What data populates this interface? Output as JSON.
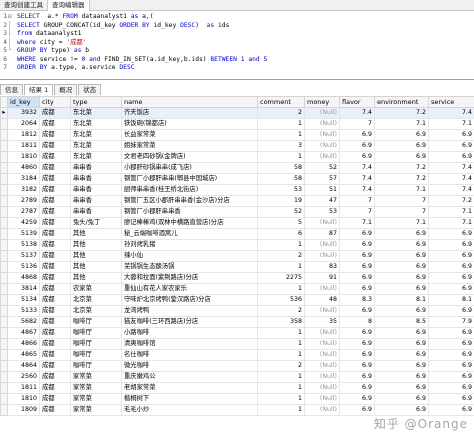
{
  "top_tabs": [
    "查询创建工具",
    "查询编辑器"
  ],
  "sql": {
    "lines": [
      {
        "no": "1",
        "fold": "⊟",
        "html": "<span class='kw'>SELECT</span>  a.* <span class='kw'>FROM</span> dataanalyst1 <span class='kw'>as</span> a,("
      },
      {
        "no": "2",
        "fold": "│",
        "html": "<span class='kw'>SELECT</span> GROUP_CONCAT(id_key <span class='kw'>ORDER BY</span> id_key <span class='kw'>DESC</span>)  <span class='kw'>as</span> ids"
      },
      {
        "no": "3",
        "fold": "│",
        "html": "<span class='kw'>from</span> dataanalyst1"
      },
      {
        "no": "4",
        "fold": "│",
        "html": "<span class='kw'>where</span> city = <span class='str'>'成都'</span>"
      },
      {
        "no": "5",
        "fold": "└",
        "html": "<span class='kw'>GROUP BY</span> type) <span class='kw'>as</span> b"
      },
      {
        "no": "6",
        "fold": "",
        "html": "<span class='kw'>WHERE</span> service != <span class='num'>0</span> <span class='kw'>and</span> FIND_IN_SET(a.id_key,b.ids) <span class='kw'>BETWEEN</span> <span class='num'>1</span> <span class='kw'>and</span> <span class='num'>5</span>"
      },
      {
        "no": "7",
        "fold": "",
        "html": "<span class='kw'>ORDER BY</span> a.type, a.service <span class='kw'>DESC</span>"
      }
    ]
  },
  "result_tabs": [
    "信息",
    "结果 1",
    "概况",
    "状态"
  ],
  "table": {
    "columns": [
      "id_key",
      "city",
      "type",
      "name",
      "comment",
      "money",
      "flavor",
      "environment",
      "service"
    ],
    "rows": [
      [
        "3932",
        "成都",
        "东北菜",
        "齐天饭店",
        "2",
        "(Null)",
        "7.4",
        "7.2",
        "7.4"
      ],
      [
        "2064",
        "成都",
        "东北菜",
        "铁饭碗(锦都店)",
        "1",
        "(Null)",
        "7",
        "7.1",
        "7.1"
      ],
      [
        "1812",
        "成都",
        "东北菜",
        "长益家常菜",
        "1",
        "(Null)",
        "6.9",
        "6.9",
        "6.9"
      ],
      [
        "1811",
        "成都",
        "东北菜",
        "姐妹家常菜",
        "3",
        "(Null)",
        "6.9",
        "6.9",
        "6.9"
      ],
      [
        "1810",
        "成都",
        "东北菜",
        "文君老四砂锅(金牌店)",
        "1",
        "(Null)",
        "6.9",
        "6.9",
        "6.9"
      ],
      [
        "4860",
        "成都",
        "串串香",
        "小郡肝砂锅串串(成飞店)",
        "58",
        "52",
        "7.4",
        "7.2",
        "7.4"
      ],
      [
        "3184",
        "成都",
        "串串香",
        "钢管厂小郡肝串串(郫县中国城店)",
        "58",
        "57",
        "7.4",
        "7.2",
        "7.4"
      ],
      [
        "3182",
        "成都",
        "串串香",
        "厨师串串香(桂王桥北街店)",
        "53",
        "51",
        "7.4",
        "7.1",
        "7.4"
      ],
      [
        "2789",
        "成都",
        "串串香",
        "钢管厂五区小郡肝串串香(金沙店)分店",
        "19",
        "47",
        "7",
        "7",
        "7.2"
      ],
      [
        "2787",
        "成都",
        "串串香",
        "钢管厂小郡肝串串香",
        "52",
        "53",
        "7",
        "7",
        "7.1"
      ],
      [
        "4259",
        "成都",
        "兔头/兔丁",
        "廖记棒棒鸡(双林中横路直营店)分店",
        "5",
        "(Null)",
        "7.1",
        "7.1",
        "7.1"
      ],
      [
        "5139",
        "成都",
        "其他",
        "秘_云端咖啡酒窝儿",
        "6",
        "87",
        "6.9",
        "6.9",
        "6.9"
      ],
      [
        "5138",
        "成都",
        "其他",
        "孙刘烤乳猪",
        "1",
        "(Null)",
        "6.9",
        "6.9",
        "6.9"
      ],
      [
        "5137",
        "成都",
        "其他",
        "辣小仙",
        "2",
        "(Null)",
        "6.9",
        "6.9",
        "6.9"
      ],
      [
        "5136",
        "成都",
        "其他",
        "芜锅锅生态酸汤锅",
        "1",
        "83",
        "6.9",
        "6.9",
        "6.9"
      ],
      [
        "4868",
        "成都",
        "其他",
        "大蓉和拉面(紫荆路店)分店",
        "2275",
        "91",
        "6.9",
        "6.9",
        "6.9"
      ],
      [
        "3814",
        "成都",
        "农家菜",
        "重仙山有花人家农家乐",
        "1",
        "(Null)",
        "6.9",
        "6.9",
        "6.9"
      ],
      [
        "5134",
        "成都",
        "北京菜",
        "守味炉北京烤鸭(蓥汉路店)分店",
        "536",
        "48",
        "8.3",
        "8.1",
        "8.1"
      ],
      [
        "5133",
        "成都",
        "北京菜",
        "龙湾烤鸭",
        "2",
        "(Null)",
        "6.9",
        "6.9",
        "6.9"
      ],
      [
        "5682",
        "成都",
        "咖啡厅",
        "猫友咖啡(三环西路店)分店",
        "358",
        "35",
        "8",
        "8.5",
        "7.9"
      ],
      [
        "4867",
        "成都",
        "咖啡厅",
        "小路咖啡",
        "1",
        "(Null)",
        "6.9",
        "6.9",
        "6.9"
      ],
      [
        "4866",
        "成都",
        "咖啡厅",
        "清爽咖啡馆",
        "1",
        "(Null)",
        "6.9",
        "6.9",
        "6.9"
      ],
      [
        "4865",
        "成都",
        "咖啡厅",
        "名仕咖啡",
        "1",
        "(Null)",
        "6.9",
        "6.9",
        "6.9"
      ],
      [
        "4864",
        "成都",
        "咖啡厅",
        "微光咖啡",
        "2",
        "(Null)",
        "6.9",
        "6.9",
        "6.9"
      ],
      [
        "2560",
        "成都",
        "家常菜",
        "重庆嫩鸡公",
        "1",
        "(Null)",
        "6.9",
        "6.9",
        "6.9"
      ],
      [
        "1811",
        "成都",
        "家常菜",
        "老胡家常菜",
        "1",
        "(Null)",
        "6.9",
        "6.9",
        "6.9"
      ],
      [
        "1810",
        "成都",
        "家常菜",
        "楷桐树下",
        "1",
        "(Null)",
        "6.9",
        "6.9",
        "6.9"
      ],
      [
        "1809",
        "成都",
        "家常菜",
        "毛毛小炒",
        "1",
        "(Null)",
        "6.9",
        "6.9",
        "6.9"
      ]
    ]
  },
  "watermark": "知乎 @Orange"
}
